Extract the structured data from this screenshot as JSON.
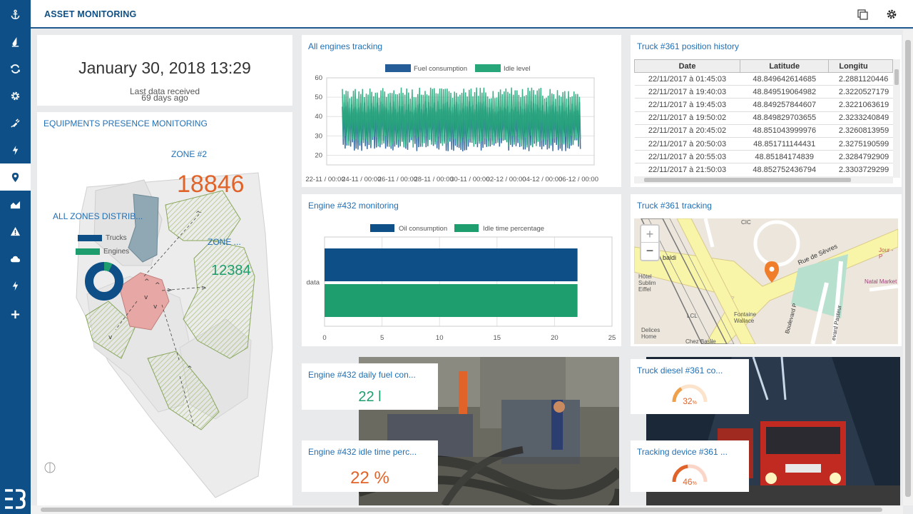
{
  "app": {
    "title": "ASSET MONITORING"
  },
  "sidebar": {
    "items": [
      {
        "icon": "anchor-icon"
      },
      {
        "icon": "oil-drop-icon"
      },
      {
        "icon": "sync-icon"
      },
      {
        "icon": "gear-icon"
      },
      {
        "icon": "plug-icon"
      },
      {
        "icon": "lightning-icon"
      },
      {
        "icon": "location-pin-icon",
        "active": true
      },
      {
        "icon": "area-chart-icon"
      },
      {
        "icon": "warning-icon"
      },
      {
        "icon": "cloud-icon"
      },
      {
        "icon": "lightning-icon"
      },
      {
        "icon": "plus-icon"
      }
    ]
  },
  "last_data": {
    "datetime": "January 30, 2018 13:29",
    "label": "Last data received",
    "ago": "69 days ago"
  },
  "presence": {
    "title": "EQUIPMENTS PRESENCE MONITORING",
    "zone2_label": "ZONE #2",
    "zone2_value": "18846",
    "zone_other_label": "ZONE ...",
    "zone_other_value": "12384",
    "distrib_label": "ALL ZONES DISTRIB...",
    "distrib_legend": [
      "Trucks",
      "Engines"
    ],
    "distrib_values": [
      0.93,
      0.07
    ],
    "colors": {
      "trucks": "#0d4f86",
      "engines": "#1e9e6e",
      "orange": "#e0642a"
    }
  },
  "engines_tracking": {
    "title": "All engines tracking",
    "chart_data": {
      "type": "line",
      "series": [
        {
          "name": "Fuel consumption",
          "color": "#245d98"
        },
        {
          "name": "Idle level",
          "color": "#27a67a"
        }
      ],
      "ylim": [
        15,
        60
      ],
      "yticks": [
        20,
        30,
        40,
        50,
        60
      ],
      "x_ticks": [
        "22-11 / 00:00",
        "24-11 / 00:00",
        "26-11 / 00:00",
        "28-11 / 00:00",
        "30-11 / 00:00",
        "02-12 / 00:00",
        "04-12 / 00:00",
        "06-12 / 00:00"
      ]
    }
  },
  "position_history": {
    "title": "Truck #361 position history",
    "columns": [
      "Date",
      "Latitude",
      "Longitu"
    ],
    "rows": [
      [
        "22/11/2017 à 01:45:03",
        "48.849642614685",
        "2.2881120446"
      ],
      [
        "22/11/2017 à 19:40:03",
        "48.849519064982",
        "2.3220527179"
      ],
      [
        "22/11/2017 à 19:45:03",
        "48.849257844607",
        "2.3221063619"
      ],
      [
        "22/11/2017 à 19:50:02",
        "48.849829703655",
        "2.3233240849"
      ],
      [
        "22/11/2017 à 20:45:02",
        "48.851043999976",
        "2.3260813959"
      ],
      [
        "22/11/2017 à 20:50:03",
        "48.851711144431",
        "2.3275190599"
      ],
      [
        "22/11/2017 à 20:55:03",
        "48.85184174839",
        "2.3284792909"
      ],
      [
        "22/11/2017 à 21:50:03",
        "48.852752436794",
        "2.3303729299"
      ]
    ]
  },
  "engine_monitoring": {
    "title": "Engine #432 monitoring",
    "chart_data": {
      "type": "bar",
      "orientation": "horizontal",
      "categories": [
        "data"
      ],
      "series": [
        {
          "name": "Oil consumption",
          "values": [
            22
          ],
          "color": "#0d4f86"
        },
        {
          "name": "Idle time percentage",
          "values": [
            22
          ],
          "color": "#1e9e6e"
        }
      ],
      "xlim": [
        0,
        25
      ],
      "xticks": [
        0,
        5,
        10,
        15,
        20,
        25
      ]
    }
  },
  "truck_tracking": {
    "title": "Truck #361 tracking",
    "zoom_in": "+",
    "zoom_out": "−",
    "map_labels": [
      "CIC",
      "Rue de Sèvres",
      "Hôtel Sublim Eiffel",
      "LCL",
      "Fontaine Wallace",
      "Boulevard P",
      "Delices Home",
      "Chez Basile",
      "Natal Market",
      "Jour - P",
      "baldi",
      "evard Pasteur"
    ]
  },
  "kpis": [
    {
      "title": "Engine #432 daily fuel con...",
      "value": "22 l",
      "color": "#1e9e6e"
    },
    {
      "title": "Engine #432 idle time perc...",
      "value": "22 %",
      "color": "#e0642a"
    },
    {
      "title": "Truck diesel #361 co...",
      "value": "32",
      "unit": "%",
      "fraction": 0.32,
      "color": "#f0a04a"
    },
    {
      "title": "Tracking device #361 ...",
      "value": "46",
      "unit": "%",
      "fraction": 0.46,
      "color": "#e0642a"
    }
  ]
}
